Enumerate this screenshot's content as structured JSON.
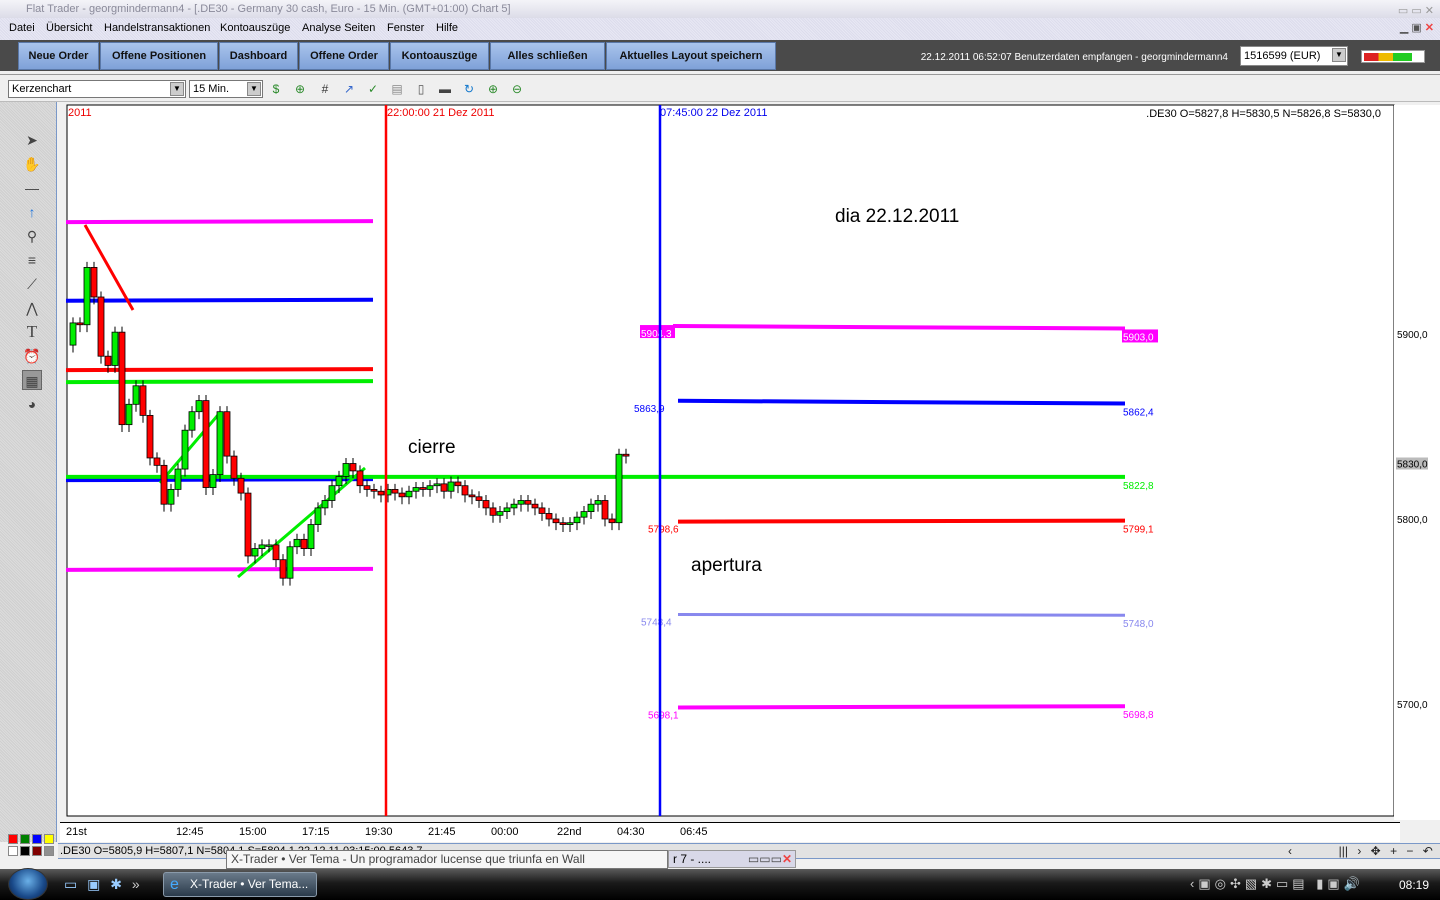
{
  "window": {
    "title": "Flat Trader - georgmindermann4  - [.DE30 - Germany 30 cash, Euro - 15 Min. (GMT+01:00)   Chart 5]"
  },
  "menu": [
    "Datei",
    "Übersicht",
    "Handelstransaktionen",
    "Kontoauszüge",
    "Analyse Seiten",
    "Fenster",
    "Hilfe"
  ],
  "buttons": [
    "Neue Order",
    "Offene Positionen",
    "Dashboard",
    "Offene Order",
    "Kontoauszüge",
    "Alles schließen",
    "Aktuelles Layout speichern"
  ],
  "status_message": "22.12.2011 06:52:07 Benutzerdaten empfangen - georgmindermann4",
  "account": "1516599 (EUR)",
  "signal_strength": 0.8,
  "toolbar": {
    "chart_type": "Kerzenchart",
    "interval": "15 Min."
  },
  "chart_data": {
    "type": "candlestick",
    "symbol_info": ".DE30 O=5827,8 H=5830,5 N=5826,8 S=5830,0",
    "year_label": "2011",
    "price_axis": {
      "ticks": [
        "5900,0",
        "5830,0",
        "5800,0",
        "5700,0"
      ],
      "tick_values": [
        5900,
        5830,
        5800,
        5700
      ],
      "current": 5830,
      "range": [
        5640,
        6025
      ]
    },
    "time_ticks": [
      "21st",
      "12:45",
      "15:00",
      "17:15",
      "19:30",
      "21:45",
      "00:00",
      "22nd",
      "04:30",
      "06:45"
    ],
    "vertical_markers": [
      {
        "label": "22:00:00 21 Dez 2011",
        "color": "#ff0000"
      },
      {
        "label": "07:45:00 22 Dez 2011",
        "color": "#0000ff"
      }
    ],
    "closes": [
      5906,
      5905,
      5936,
      5920,
      5888,
      5883,
      5901,
      5851,
      5862,
      5872,
      5856,
      5833,
      5829,
      5808,
      5816,
      5827,
      5848,
      5858,
      5864,
      5817,
      5824,
      5858,
      5834,
      5822,
      5814,
      5780,
      5784,
      5786,
      5786,
      5778,
      5768,
      5785,
      5789,
      5784,
      5797,
      5806,
      5810,
      5818,
      5823,
      5830,
      5826,
      5818,
      5816,
      5815,
      5813,
      5816,
      5814,
      5812,
      5815,
      5817,
      5816,
      5818,
      5819,
      5815,
      5820,
      5818,
      5813,
      5812,
      5810,
      5806,
      5802,
      5804,
      5806,
      5808,
      5810,
      5808,
      5806,
      5803,
      5800,
      5798,
      5797,
      5798,
      5801,
      5804,
      5808,
      5810,
      5800,
      5798,
      5835,
      5834
    ],
    "first_open": 5894,
    "prior_day_levels": [
      {
        "value": 5960.5,
        "color": "#ff00ff"
      },
      {
        "value": 5918,
        "color": "#0000ff"
      },
      {
        "value": 5880.5,
        "color": "#ff0000"
      },
      {
        "value": 5874,
        "color": "#00ee00"
      },
      {
        "value": 5821,
        "color": "#0000ff"
      },
      {
        "value": 5772.5,
        "color": "#ff00ff"
      }
    ],
    "levels": [
      {
        "start_label": "5904,3",
        "end_label": "5903,0",
        "start": 5904.3,
        "end": 5903.0,
        "color": "#ff00ff"
      },
      {
        "start_label": "5863,9",
        "end_label": "5862,4",
        "start": 5863.9,
        "end": 5862.4,
        "color": "#0000ff"
      },
      {
        "start_label": "",
        "end_label": "5822,8",
        "start": 5822.8,
        "end": 5822.8,
        "color": "#00ee00"
      },
      {
        "start_label": "5798,6",
        "end_label": "5799,1",
        "start": 5798.6,
        "end": 5799.1,
        "color": "#ff0000"
      },
      {
        "start_label": "5748,4",
        "end_label": "5748,0",
        "start": 5748.4,
        "end": 5748.0,
        "color": "#8888ee"
      },
      {
        "start_label": "5698,1",
        "end_label": "5698,8",
        "start": 5698.1,
        "end": 5698.8,
        "color": "#ff00ff"
      }
    ],
    "annotations": [
      "dia 22.12.2011",
      "cierre",
      "apertura"
    ]
  },
  "statusbar": ".DE30 O=5805,9 H=5807,1 N=5804,1 S=5804,1   22.12.11 03:15:00 5643,7",
  "tooltip": "X-Trader • Ver Tema - Un programador lucense que triunfa en Wall Street#p169099",
  "min_window": "r 7 - ....",
  "taskbar": {
    "task": "X-Trader • Ver Tema...",
    "clock": "08:19"
  },
  "palette_colors": [
    "#ff0000",
    "#008000",
    "#0000ff",
    "#ffff00",
    "#ffffff",
    "#000000",
    "#800000",
    "#909090"
  ]
}
